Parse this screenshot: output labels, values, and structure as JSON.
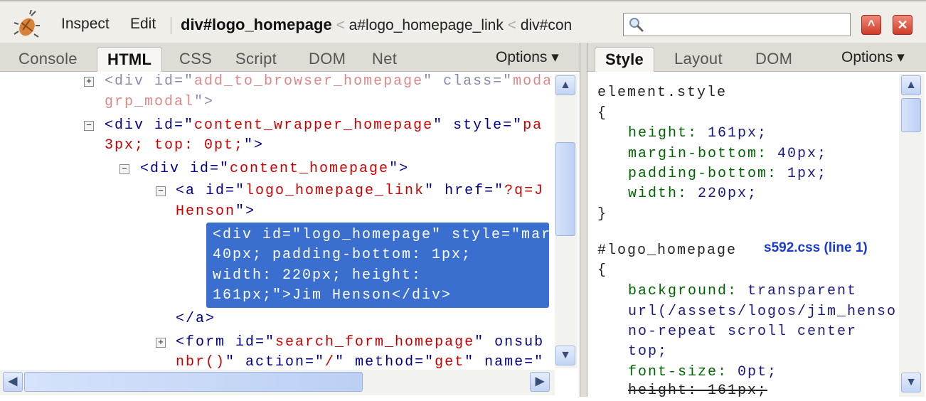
{
  "toolbar": {
    "inspect": "Inspect",
    "edit": "Edit",
    "breadcrumb": [
      "div#logo_homepage",
      "a#logo_homepage_link",
      "div#con"
    ],
    "breadcrumb_sep": "<",
    "search_placeholder": "",
    "minimize_glyph": "^",
    "close_glyph": "✕"
  },
  "left_tabs": [
    "Console",
    "HTML",
    "CSS",
    "Script",
    "DOM",
    "Net"
  ],
  "left_active_tab": "HTML",
  "right_tabs": [
    "Style",
    "Layout",
    "DOM"
  ],
  "right_active_tab": "Style",
  "options_label": "Options ▾",
  "html_panel": {
    "lines": [
      {
        "toggle": "+",
        "depth": 0,
        "segs": [
          [
            "<div id=\"",
            "faded"
          ],
          [
            "add_to_browser_homepage",
            "fval"
          ],
          [
            "\" class=\"",
            "faded"
          ],
          [
            "moda",
            "fval"
          ]
        ]
      },
      {
        "depth": 0,
        "segs": [
          [
            "grp_modal",
            "fval"
          ],
          [
            "\">",
            "faded"
          ]
        ]
      },
      {
        "toggle": "−",
        "depth": 0,
        "segs": [
          [
            "<div id=\"",
            "tag"
          ],
          [
            "content_wrapper_homepage",
            "val"
          ],
          [
            "\" style=\"",
            "tag"
          ],
          [
            "pa",
            "val"
          ]
        ]
      },
      {
        "depth": 0,
        "segs": [
          [
            "3px; top: 0pt;",
            "val"
          ],
          [
            "\">",
            "tag"
          ]
        ]
      },
      {
        "toggle": "−",
        "depth": 1,
        "segs": [
          [
            "<div id=\"",
            "tag"
          ],
          [
            "content_homepage",
            "val"
          ],
          [
            "\">",
            "tag"
          ]
        ]
      },
      {
        "toggle": "−",
        "depth": 2,
        "segs": [
          [
            "<a id=\"",
            "tag"
          ],
          [
            "logo_homepage_link",
            "val"
          ],
          [
            "\" href=\"",
            "tag"
          ],
          [
            "?q=J",
            "val"
          ]
        ]
      },
      {
        "depth": 2,
        "segs": [
          [
            "Henson",
            "val"
          ],
          [
            "\">",
            "tag"
          ]
        ]
      },
      {
        "depth": 3,
        "selected": true,
        "segs": [
          [
            "<div id=\"logo_homepage\" style=\"mar",
            "sel"
          ]
        ]
      },
      {
        "depth": 3,
        "selected": true,
        "segs": [
          [
            "40px; padding-bottom: 1px;",
            "sel"
          ]
        ]
      },
      {
        "depth": 3,
        "selected": true,
        "segs": [
          [
            "width: 220px; height:",
            "sel"
          ]
        ]
      },
      {
        "depth": 3,
        "selected": true,
        "segs": [
          [
            "161px;\">Jim Henson</div>",
            "sel"
          ]
        ]
      },
      {
        "depth": 2,
        "segs": [
          [
            "</a>",
            "tag"
          ]
        ]
      },
      {
        "toggle": "+",
        "depth": 2,
        "segs": [
          [
            "<form id=\"",
            "tag"
          ],
          [
            "search_form_homepage",
            "val"
          ],
          [
            "\" onsub",
            "tag"
          ]
        ]
      },
      {
        "depth": 2,
        "segs": [
          [
            "nbr()",
            "val"
          ],
          [
            "\" action=\"",
            "tag"
          ],
          [
            "/",
            "val"
          ],
          [
            "\" method=\"",
            "tag"
          ],
          [
            "get",
            "val"
          ],
          [
            "\" name=\"",
            "tag"
          ]
        ]
      }
    ]
  },
  "style_panel": {
    "source_link": "s592.css (line 1)",
    "lines": [
      {
        "indent": 0,
        "segs": [
          [
            "element.style",
            "plain"
          ]
        ]
      },
      {
        "indent": 0,
        "segs": [
          [
            "{",
            "plain"
          ]
        ]
      },
      {
        "indent": 1,
        "segs": [
          [
            "height: ",
            "prop"
          ],
          [
            "161px;",
            "pval"
          ]
        ]
      },
      {
        "indent": 1,
        "segs": [
          [
            "margin-bottom: ",
            "prop"
          ],
          [
            "40px;",
            "pval"
          ]
        ]
      },
      {
        "indent": 1,
        "segs": [
          [
            "padding-bottom: ",
            "prop"
          ],
          [
            "1px;",
            "pval"
          ]
        ]
      },
      {
        "indent": 1,
        "segs": [
          [
            "width: ",
            "prop"
          ],
          [
            "220px;",
            "pval"
          ]
        ]
      },
      {
        "indent": 0,
        "segs": [
          [
            "}",
            "plain"
          ]
        ]
      },
      {
        "indent": 0,
        "gap": true,
        "segs": [
          [
            "#logo_homepage",
            "plain"
          ]
        ]
      },
      {
        "indent": 0,
        "segs": [
          [
            "{",
            "plain"
          ]
        ]
      },
      {
        "indent": 1,
        "segs": [
          [
            "background: ",
            "prop"
          ],
          [
            "transparent",
            "pval"
          ]
        ]
      },
      {
        "indent": 1,
        "segs": [
          [
            "url(/assets/logos/jim_henso",
            "pval"
          ]
        ]
      },
      {
        "indent": 1,
        "segs": [
          [
            "no-repeat scroll center",
            "pval"
          ]
        ]
      },
      {
        "indent": 1,
        "segs": [
          [
            "top;",
            "pval"
          ]
        ]
      },
      {
        "indent": 1,
        "segs": [
          [
            "font-size: ",
            "prop"
          ],
          [
            "0pt;",
            "pval"
          ]
        ]
      },
      {
        "indent": 1,
        "segs": [
          [
            "height: 161px;",
            "strike"
          ]
        ]
      }
    ]
  },
  "scrollbar": {
    "up": "▲",
    "down": "▼",
    "left": "◀",
    "right": "▶"
  }
}
